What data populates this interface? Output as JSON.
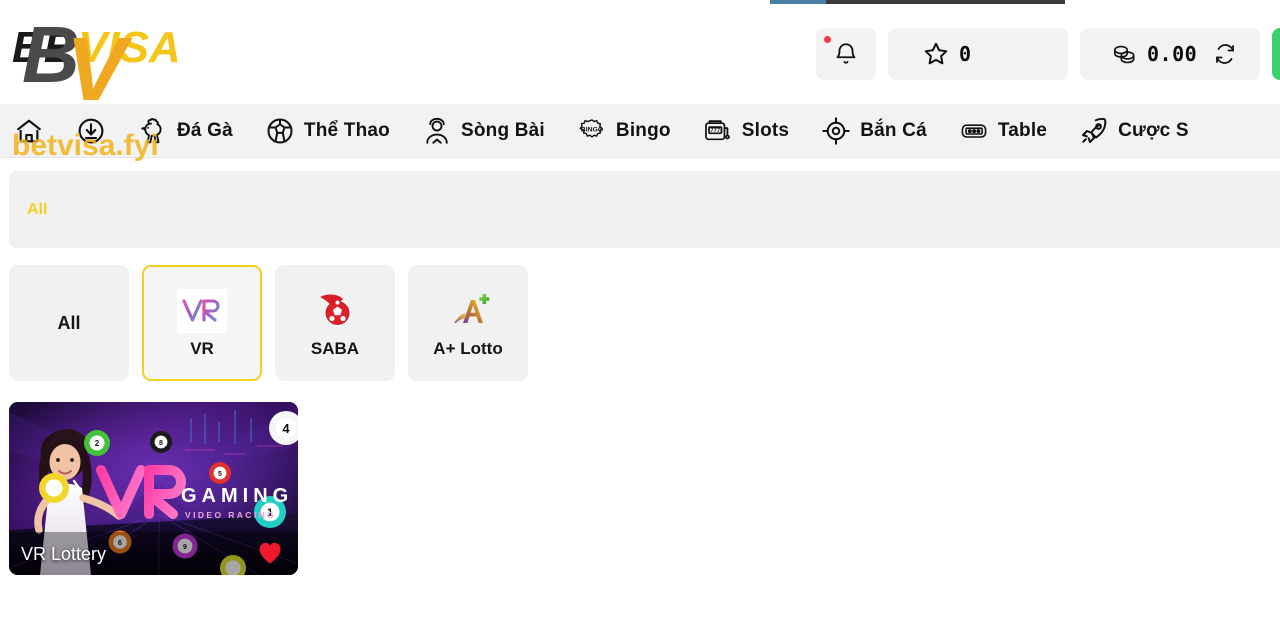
{
  "brand": {
    "logo_text_back": "BETVISA",
    "logo_mark": "BV",
    "watermark": "betvisa.fyi",
    "yellow": "#f5c518",
    "dark": "#3d3d3d",
    "accent_yellow": "#f2d022",
    "green": "#3ccf6e"
  },
  "header": {
    "notification_icon": "bell-icon",
    "notification_badge": true,
    "favorite_icon": "star-icon",
    "favorite_count": "0",
    "balance_icon": "coins-icon",
    "balance_amount": "0.00",
    "refresh_icon": "refresh-icon",
    "cta_icon": "green-button"
  },
  "nav": {
    "items": [
      {
        "label": "",
        "icon": "home-icon"
      },
      {
        "label": "",
        "icon": "deposit-download-icon"
      },
      {
        "label": "Đá Gà",
        "icon": "rooster-icon"
      },
      {
        "label": "Thể Thao",
        "icon": "soccer-ball-icon"
      },
      {
        "label": "Sòng Bài",
        "icon": "live-dealer-icon"
      },
      {
        "label": "Bingo",
        "icon": "bingo-icon"
      },
      {
        "label": "Slots",
        "icon": "slot-machine-icon"
      },
      {
        "label": "Bắn Cá",
        "icon": "fish-shooting-target-icon"
      },
      {
        "label": "Table",
        "icon": "domino-table-icon"
      },
      {
        "label": "Cược S",
        "icon": "rocket-icon"
      }
    ]
  },
  "tabs": {
    "active": "All"
  },
  "providers": [
    {
      "label": "All",
      "logo": "text-all"
    },
    {
      "label": "VR",
      "logo": "vr-logo",
      "selected": true
    },
    {
      "label": "SABA",
      "logo": "saba-logo"
    },
    {
      "label": "A+ Lotto",
      "logo": "aplus-lotto-logo"
    }
  ],
  "games": [
    {
      "title": "VR Lottery",
      "art_title": "VR",
      "art_subtitle": "GAMING",
      "art_tagline": "VIDEO RACING",
      "favorited": true,
      "favorite_icon": "heart-icon"
    }
  ]
}
